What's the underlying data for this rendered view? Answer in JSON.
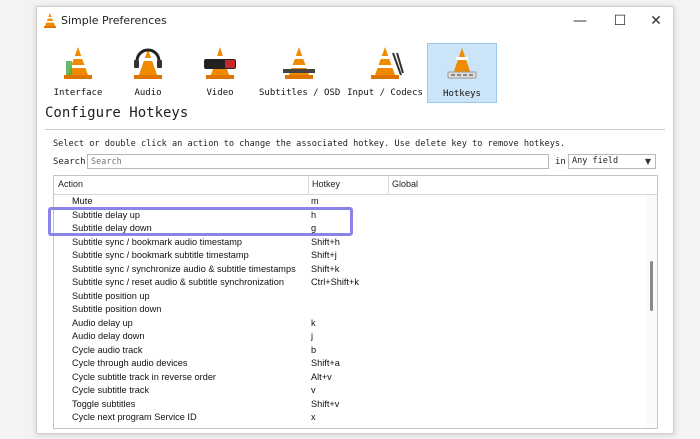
{
  "window": {
    "title": "Simple Preferences",
    "controls": {
      "minimize": "—",
      "maximize": "☐",
      "close": "✕"
    }
  },
  "toolbar": {
    "items": [
      {
        "label": "Interface",
        "icon": "interface-cone-icon"
      },
      {
        "label": "Audio",
        "icon": "audio-cone-icon"
      },
      {
        "label": "Video",
        "icon": "video-cone-icon"
      },
      {
        "label": "Subtitles / OSD",
        "icon": "subtitles-cone-icon"
      },
      {
        "label": "Input / Codecs",
        "icon": "input-codecs-cone-icon"
      },
      {
        "label": "Hotkeys",
        "icon": "hotkeys-cone-icon",
        "selected": true
      }
    ]
  },
  "section": {
    "heading": "Configure Hotkeys",
    "instructions": "Select or double click an action to change the associated hotkey. Use delete key to remove hotkeys."
  },
  "search": {
    "label": "Search",
    "placeholder": "Search",
    "in_label": "in",
    "field_value": "Any field"
  },
  "table": {
    "columns": [
      "Action",
      "Hotkey",
      "Global"
    ],
    "rows": [
      {
        "action": "Mute",
        "hotkey": "m"
      },
      {
        "action": "Subtitle delay up",
        "hotkey": "h"
      },
      {
        "action": "Subtitle delay down",
        "hotkey": "g"
      },
      {
        "action": "Subtitle sync / bookmark audio timestamp",
        "hotkey": "Shift+h"
      },
      {
        "action": "Subtitle sync / bookmark subtitle timestamp",
        "hotkey": "Shift+j"
      },
      {
        "action": "Subtitle sync / synchronize audio & subtitle timestamps",
        "hotkey": "Shift+k"
      },
      {
        "action": "Subtitle sync / reset audio & subtitle synchronization",
        "hotkey": "Ctrl+Shift+k"
      },
      {
        "action": "Subtitle position up",
        "hotkey": ""
      },
      {
        "action": "Subtitle position down",
        "hotkey": ""
      },
      {
        "action": "Audio delay up",
        "hotkey": "k"
      },
      {
        "action": "Audio delay down",
        "hotkey": "j"
      },
      {
        "action": "Cycle audio track",
        "hotkey": "b"
      },
      {
        "action": "Cycle through audio devices",
        "hotkey": "Shift+a"
      },
      {
        "action": "Cycle subtitle track in reverse order",
        "hotkey": "Alt+v"
      },
      {
        "action": "Cycle subtitle track",
        "hotkey": "v"
      },
      {
        "action": "Toggle subtitles",
        "hotkey": "Shift+v"
      },
      {
        "action": "Cycle next program Service ID",
        "hotkey": "x"
      }
    ]
  },
  "colors": {
    "highlight_border": "#8b84e8",
    "selected_tab_bg": "#cce4f7",
    "cone_orange": "#f08a00"
  }
}
